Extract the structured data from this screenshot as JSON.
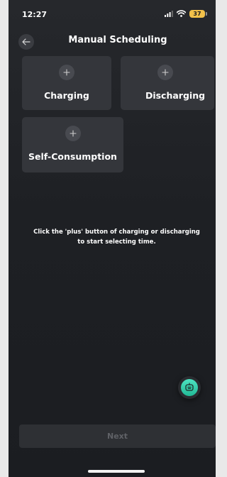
{
  "status_bar": {
    "time": "12:27",
    "battery_level": "37",
    "battery_color": "#f2c14a",
    "icons": [
      "signal-icon",
      "wifi-icon",
      "battery-icon"
    ]
  },
  "header": {
    "title": "Manual Scheduling",
    "back_icon": "back-arrow-icon"
  },
  "modes": [
    {
      "label": "Charging",
      "icon": "plus-icon"
    },
    {
      "label": "Discharging",
      "icon": "plus-icon"
    },
    {
      "label": "Self-Consumption",
      "icon": "plus-icon"
    }
  ],
  "instruction": "Click the 'plus' button of charging or discharging to start selecting time.",
  "assistant": {
    "icon": "robot-assistant-icon",
    "accent_color": "#2fd1ab"
  },
  "footer": {
    "next_label": "Next",
    "next_enabled": false
  },
  "colors": {
    "background": "#1e2024",
    "tile": "#34363b",
    "text": "#ffffff",
    "disabled_text": "#5f6166"
  }
}
